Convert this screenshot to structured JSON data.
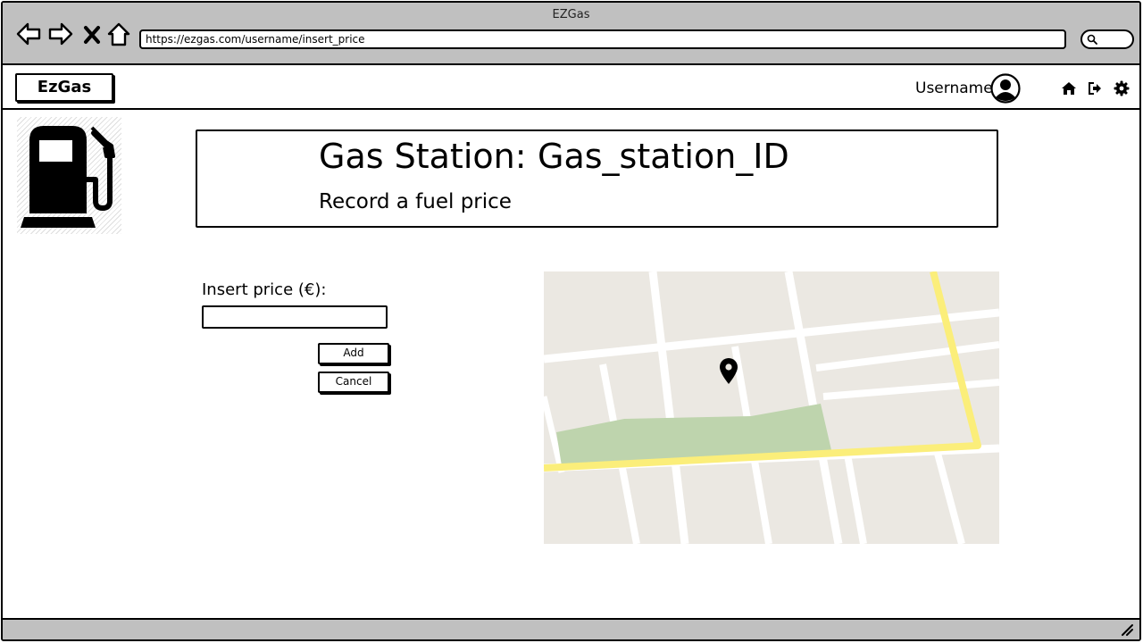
{
  "window": {
    "title": "EZGas",
    "url": "https://ezgas.com/username/insert_price"
  },
  "appbar": {
    "logo": "EzGas",
    "username": "Username",
    "icons": [
      "home-icon",
      "logout-icon",
      "gear-icon"
    ]
  },
  "header": {
    "station_label": "Gas Station:",
    "station_id": "Gas_station_ID",
    "subtitle": "Record a fuel price"
  },
  "form": {
    "price_label": "Insert price (€):",
    "price_value": "",
    "add_label": "Add",
    "cancel_label": "Cancel"
  },
  "colors": {
    "chrome": "#c0c0c0",
    "map_land": "#ebe8e2",
    "map_park": "#bed4ad",
    "map_highway": "#fbee7a",
    "map_road": "#ffffff"
  }
}
